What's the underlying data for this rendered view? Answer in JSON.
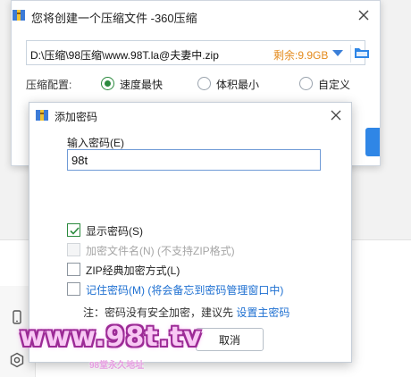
{
  "main_dialog": {
    "title": "您将创建一个压缩文件 -360压缩",
    "path_value": "D:\\压缩\\98压缩\\www.98T.la@夫妻中.zip",
    "free_space": "剩余:9.9GB",
    "config_label": "压缩配置:",
    "options": [
      {
        "label": "速度最快",
        "selected": true
      },
      {
        "label": "体积最小",
        "selected": false
      },
      {
        "label": "自定义",
        "selected": false
      }
    ]
  },
  "password_dialog": {
    "title": "添加密码",
    "input_label": "输入密码(E)",
    "input_value": "98t",
    "checkboxes": {
      "show_password": {
        "label": "显示密码(S)",
        "checked": true,
        "disabled": false
      },
      "encrypt_filenames": {
        "label": "加密文件名(N) (不支持ZIP格式)",
        "checked": false,
        "disabled": true
      },
      "zip_classic": {
        "label": "ZIP经典加密方式(L)",
        "checked": false,
        "disabled": false
      },
      "remember_password": {
        "label": "记住密码(M)",
        "suffix": " (将会备忘到密码管理窗口中)",
        "checked": false,
        "disabled": false
      }
    },
    "note_prefix": "注：密码没有安全加密，建议先 ",
    "note_link": "设置主密码",
    "cancel_label": "取消"
  },
  "watermark": {
    "main": "www.98t.tv",
    "sub": "98堂永久地址"
  },
  "colors": {
    "accent_blue": "#2f86e6",
    "link_blue": "#1d6fd1",
    "free_space_orange": "#e48a1c",
    "radio_green": "#2b8a3e",
    "watermark_pink": "#f8c8f4"
  },
  "icons": {
    "app": "archive-app-icon",
    "close": "close-icon",
    "dropdown": "caret-down-icon",
    "folder": "folder-icon",
    "check": "check-icon",
    "side_phone": "phone-icon",
    "side_settings": "settings-icon"
  }
}
